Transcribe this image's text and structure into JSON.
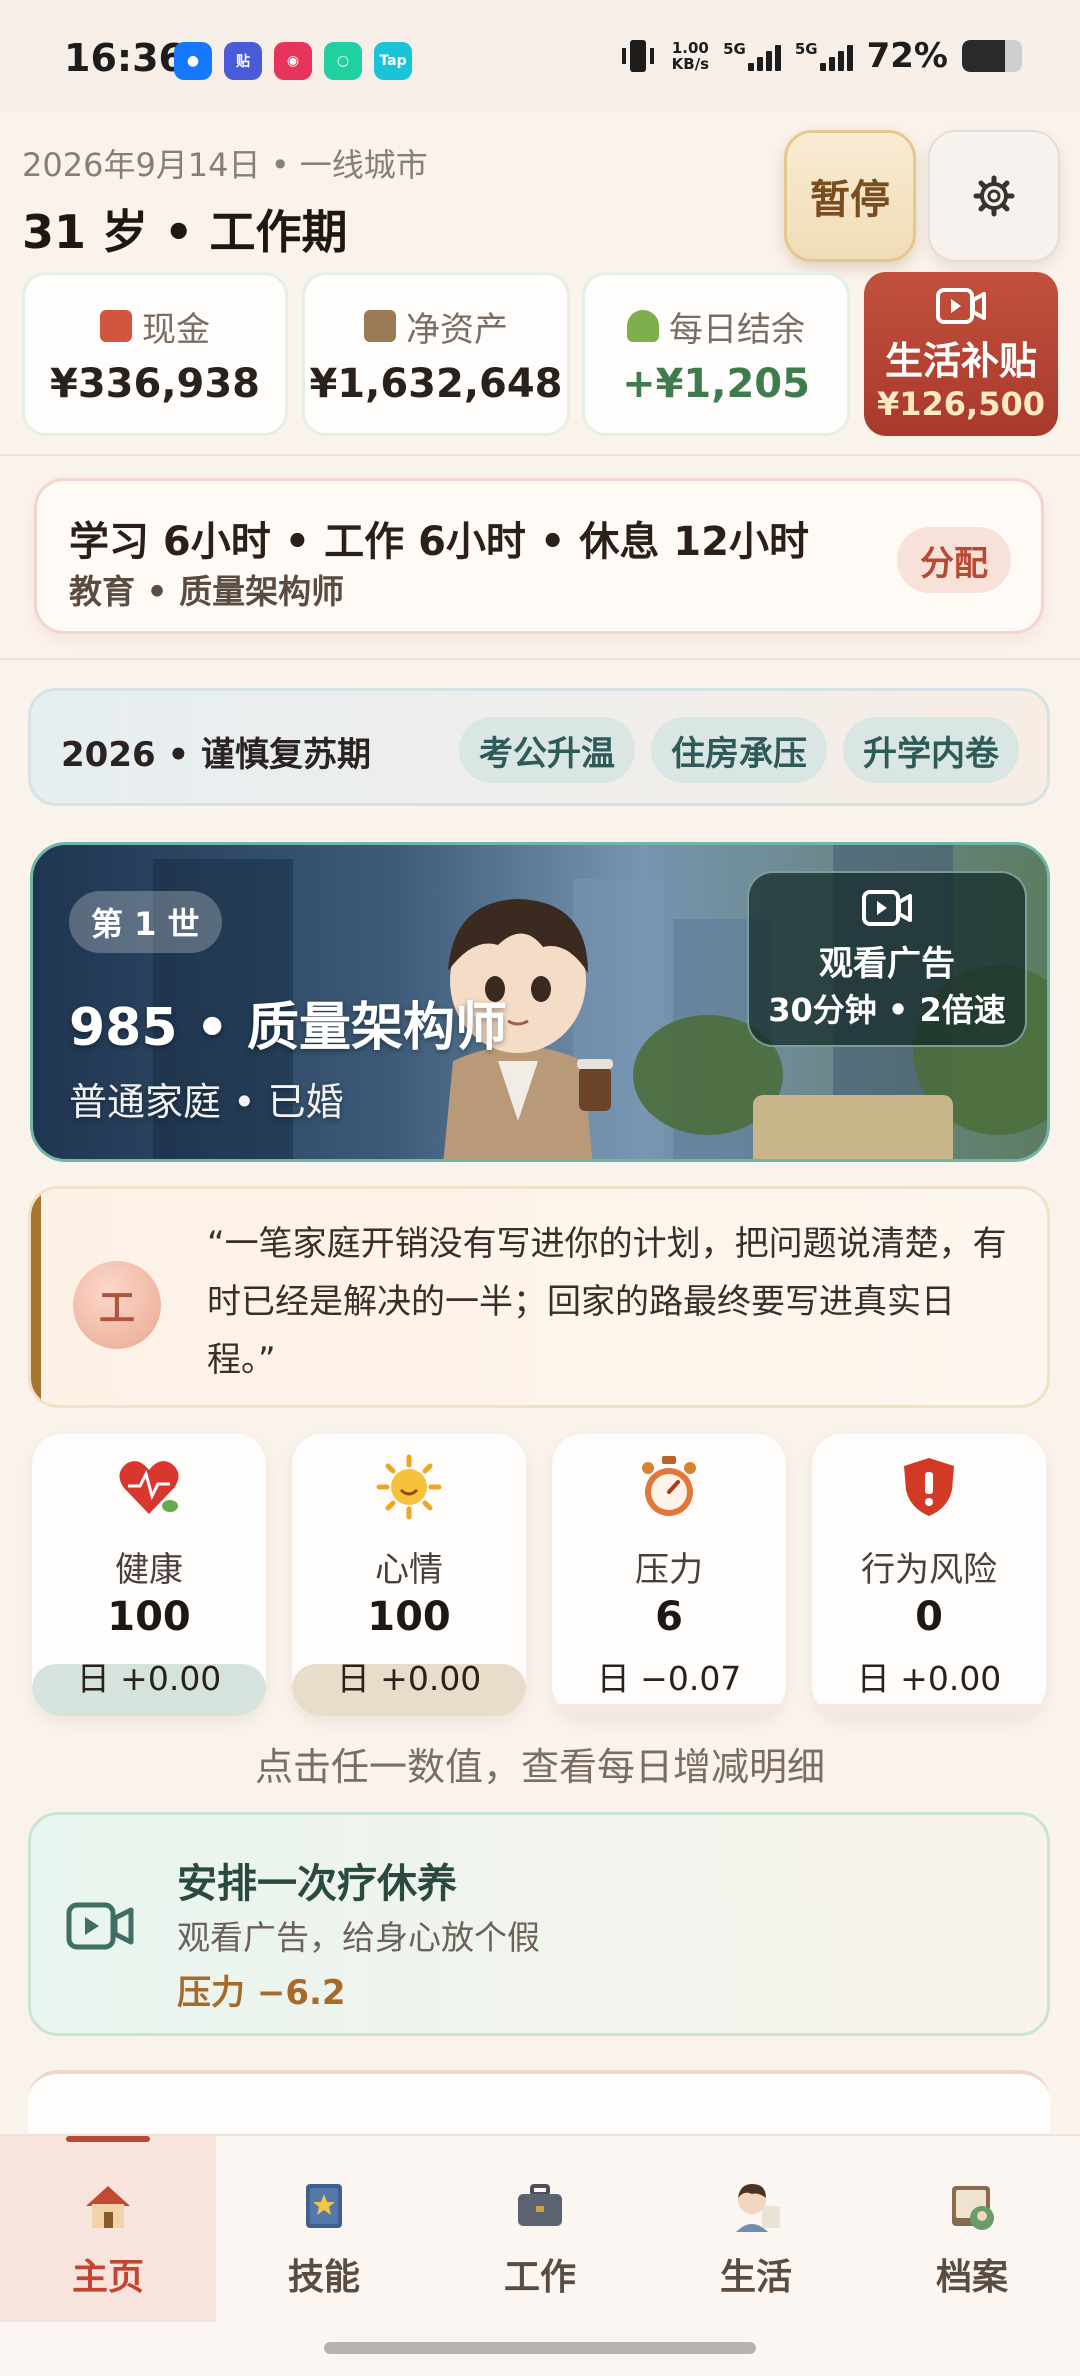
{
  "status_bar": {
    "time": "16:36",
    "net_speed_value": "1.00",
    "net_speed_unit": "KB/s",
    "signal1": "5G",
    "signal2": "5G",
    "battery": "72%",
    "apps": [
      "qq-icon",
      "tieba-icon",
      "weibo-icon",
      "wechat-icon",
      "taptap-icon"
    ]
  },
  "header": {
    "date": "2026年9月14日 • 一线城市",
    "age_phase": "31 岁 • 工作期",
    "pause_label": "暂停",
    "settings_icon": "gear-icon"
  },
  "stats": [
    {
      "label": "现金",
      "value": "¥336,938",
      "icon": "money-icon"
    },
    {
      "label": "净资产",
      "value": "¥1,632,648",
      "icon": "building-icon"
    },
    {
      "label": "每日结余",
      "value": "+¥1,205",
      "icon": "sprout-icon"
    }
  ],
  "subsidy": {
    "label": "生活补贴",
    "value": "¥126,500",
    "icon": "video-icon"
  },
  "allocation": {
    "line1": "学习 6小时 • 工作 6小时 • 休息 12小时",
    "line2": "教育 • 质量架构师",
    "button": "分配"
  },
  "era": {
    "title": "2026 • 谨慎复苏期",
    "chips": [
      "考公升温",
      "住房承压",
      "升学内卷"
    ]
  },
  "hero": {
    "badge": "第 1 世",
    "title": "985 • 质量架构师",
    "subtitle": "普通家庭 • 已婚",
    "ad_line1": "观看广告",
    "ad_line2": "30分钟 • 2倍速"
  },
  "quote": {
    "avatar_char": "工",
    "text": "“一笔家庭开销没有写进你的计划，把问题说清楚，有时已经是解决的一半；回家的路最终要写进真实日程。”"
  },
  "metrics": [
    {
      "name": "健康",
      "value": "100",
      "delta": "日 +0.00",
      "icon": "heart-icon",
      "tint": "#d6e3dc"
    },
    {
      "name": "心情",
      "value": "100",
      "delta": "日 +0.00",
      "icon": "sun-icon",
      "tint": "#e8dccb"
    },
    {
      "name": "压力",
      "value": "6",
      "delta": "日 −0.07",
      "icon": "stopwatch-icon",
      "tint": "#f3dede"
    },
    {
      "name": "行为风险",
      "value": "0",
      "delta": "日 +0.00",
      "icon": "shield-alert-icon",
      "tint": "#f3dede"
    }
  ],
  "hint": "点击任一数值，查看每日增减明细",
  "rest_card": {
    "title": "安排一次疗休养",
    "subtitle": "观看广告，给身心放个假",
    "effect": "压力 −6.2"
  },
  "bottom_nav": [
    {
      "label": "主页",
      "icon": "home-icon",
      "active": true
    },
    {
      "label": "技能",
      "icon": "book-icon",
      "active": false
    },
    {
      "label": "工作",
      "icon": "briefcase-icon",
      "active": false
    },
    {
      "label": "生活",
      "icon": "person-icon",
      "active": false
    },
    {
      "label": "档案",
      "icon": "album-icon",
      "active": false
    }
  ]
}
